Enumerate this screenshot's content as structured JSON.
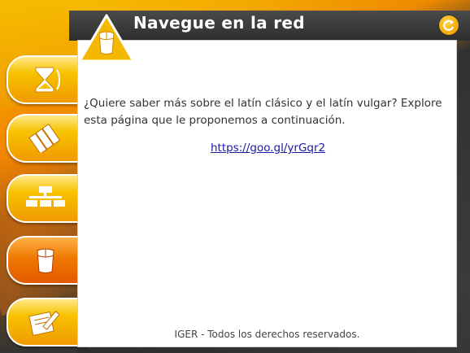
{
  "window": {
    "title": "Navegue en la red",
    "refresh_icon": "refresh-icon"
  },
  "sidebar": {
    "items": [
      {
        "id": "history",
        "icon": "hourglass-icon",
        "active": false
      },
      {
        "id": "exercises",
        "icon": "book-stack-icon",
        "active": false
      },
      {
        "id": "diagram",
        "icon": "org-chart-icon",
        "active": false
      },
      {
        "id": "web",
        "icon": "mouse-icon",
        "active": true
      },
      {
        "id": "notes",
        "icon": "pencil-paper-icon",
        "active": false
      }
    ]
  },
  "content": {
    "badge_icon": "mouse-icon",
    "question": "¿Quiere saber más sobre el latín clásico y el latín vulgar? Explore esta página que le proponemos a continuación.",
    "link_text": "https://goo.gl/yrGqr2"
  },
  "footer": {
    "text": "IGER - Todos los derechos reservados."
  },
  "colors": {
    "accent": "#f2a400",
    "active_tab": "#e35a00",
    "titlebar": "#2e2e2e",
    "link": "#1a1aa6"
  }
}
